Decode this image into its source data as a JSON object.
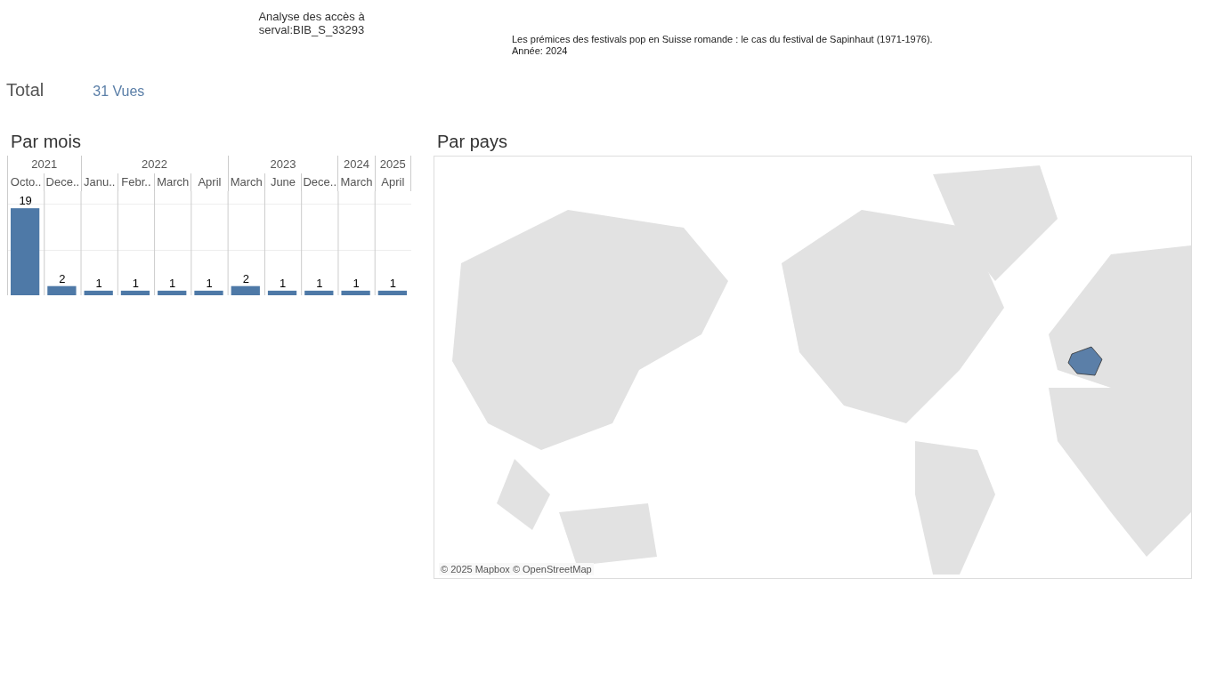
{
  "header": {
    "title": "Analyse des accès à serval:BIB_S_33293",
    "publication": "Les prémices des festivals pop en Suisse romande : le cas du festival de Sapinhaut (1971-1976).",
    "year": "Année: 2024"
  },
  "total": {
    "label": "Total",
    "value": "31 Vues"
  },
  "by_month": {
    "title": "Par mois",
    "years": [
      {
        "label": "2021",
        "months": [
          "Octo..",
          "Dece.."
        ]
      },
      {
        "label": "2022",
        "months": [
          "Janu..",
          "Febr..",
          "March",
          "April"
        ]
      },
      {
        "label": "2023",
        "months": [
          "March",
          "June",
          "Dece.."
        ]
      },
      {
        "label": "2024",
        "months": [
          "March"
        ]
      },
      {
        "label": "2025",
        "months": [
          "April"
        ]
      }
    ],
    "chart_data": {
      "type": "bar",
      "series": [
        {
          "color": "#4e79a7",
          "values": [
            19,
            2,
            1,
            1,
            1,
            1,
            2,
            1,
            1,
            1,
            1
          ]
        }
      ],
      "data_labels": true
    }
  },
  "by_country": {
    "title": "Par pays",
    "attribution": "© 2025 Mapbox © OpenStreetMap"
  }
}
